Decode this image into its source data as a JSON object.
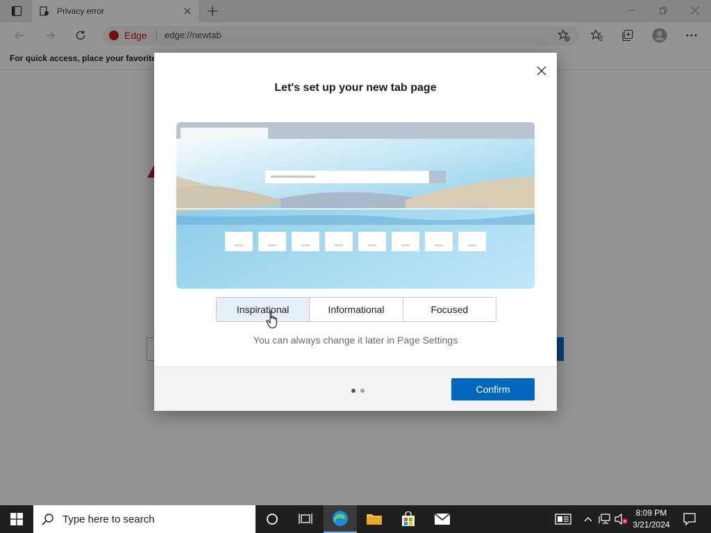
{
  "browser": {
    "tab_title": "Privacy error",
    "address_brand": "Edge",
    "url": "edge://newtab",
    "favorites_bar_text": "For quick access, place your favorites h"
  },
  "dialog": {
    "title": "Let's set up your new tab page",
    "options": [
      {
        "label": "Inspirational",
        "selected": true
      },
      {
        "label": "Informational",
        "selected": false
      },
      {
        "label": "Focused",
        "selected": false
      }
    ],
    "hint": "You can always change it later in Page Settings",
    "confirm_label": "Confirm",
    "page_indicator": {
      "current": 1,
      "total": 2
    }
  },
  "taskbar": {
    "search_placeholder": "Type here to search",
    "time": "8:09 PM",
    "date": "3/21/2024"
  },
  "icons": {
    "tab_actions": "tab-actions-icon",
    "favicon": "page-favicon-icon",
    "add_favorite": "star-plus-icon",
    "favorites": "favorites-icon",
    "collections": "collections-icon",
    "profile": "profile-icon",
    "more": "more-dots-icon"
  },
  "colors": {
    "accent": "#0067c0",
    "edge_brand": "#c4161c",
    "selected_option_bg": "#e6f0fa",
    "taskbar_bg": "#1f1f1f"
  }
}
